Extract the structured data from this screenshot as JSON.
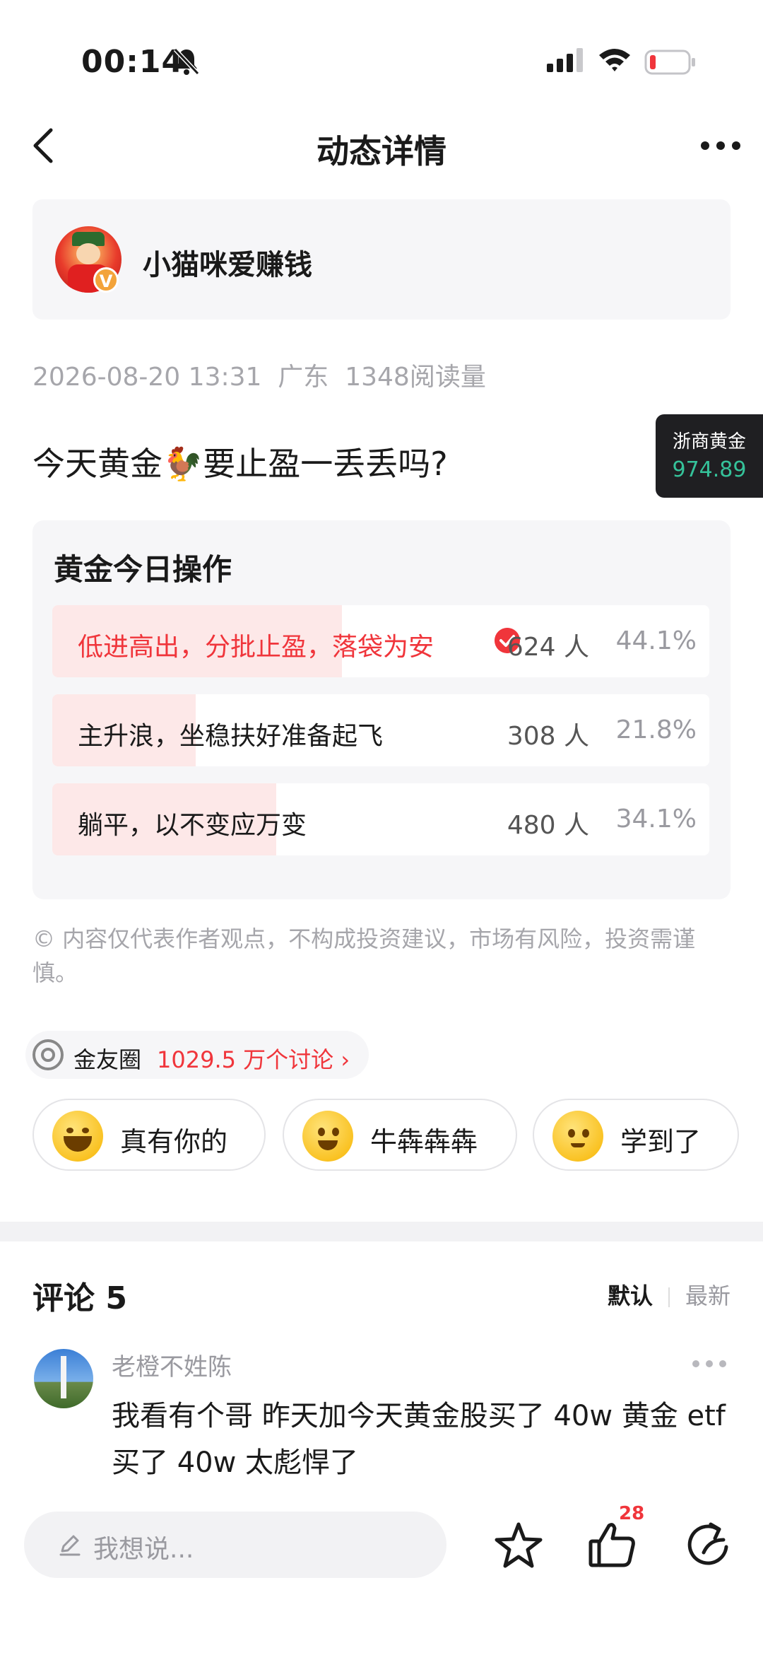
{
  "status_bar": {
    "time": "00:14"
  },
  "nav": {
    "title": "动态详情"
  },
  "author": {
    "name": "小猫咪爱赚钱",
    "badge": "V"
  },
  "meta": {
    "date": "2026-08-20 13:31",
    "location": "广东",
    "reads": "1348阅读量"
  },
  "ticker": {
    "name": "浙商黄金",
    "value": "974.89",
    "color": "#35c29a"
  },
  "post": {
    "title": "今天黄金🐓要止盈一丢丢吗?"
  },
  "poll": {
    "title": "黄金今日操作",
    "options": [
      {
        "label": "低进高出，分批止盈，落袋为安",
        "count": "624 人",
        "percent": "44.1%",
        "fraction": 0.441,
        "selected": true
      },
      {
        "label": "主升浪，坐稳扶好准备起飞",
        "count": "308 人",
        "percent": "21.8%",
        "fraction": 0.218,
        "selected": false
      },
      {
        "label": "躺平，以不变应万变",
        "count": "480 人",
        "percent": "34.1%",
        "fraction": 0.341,
        "selected": false
      }
    ]
  },
  "disclaimer": "© 内容仅代表作者观点，不构成投资建议，市场有风险，投资需谨慎。",
  "circle": {
    "name": "金友圈",
    "count": "1029.5 万个讨论 ›"
  },
  "reactions": [
    {
      "label": "真有你的",
      "icon": "laughing-emoji-icon"
    },
    {
      "label": "牛犇犇犇",
      "icon": "grinning-emoji-icon"
    },
    {
      "label": "学到了",
      "icon": "smiling-emoji-icon"
    }
  ],
  "comments": {
    "header": "评论 5",
    "sort_default": "默认",
    "sort_latest": "最新",
    "items": [
      {
        "author": "老橙不姓陈",
        "text": "我看有个哥 昨天加今天黄金股买了 40w 黄金 etf 买了 40w 太彪悍了"
      }
    ]
  },
  "bottom_bar": {
    "input_placeholder": "我想说...",
    "like_count": "28"
  },
  "colors": {
    "accent_red": "#f0353b",
    "poll_fill": "#fde8e8",
    "card_bg": "#f6f6f8"
  }
}
